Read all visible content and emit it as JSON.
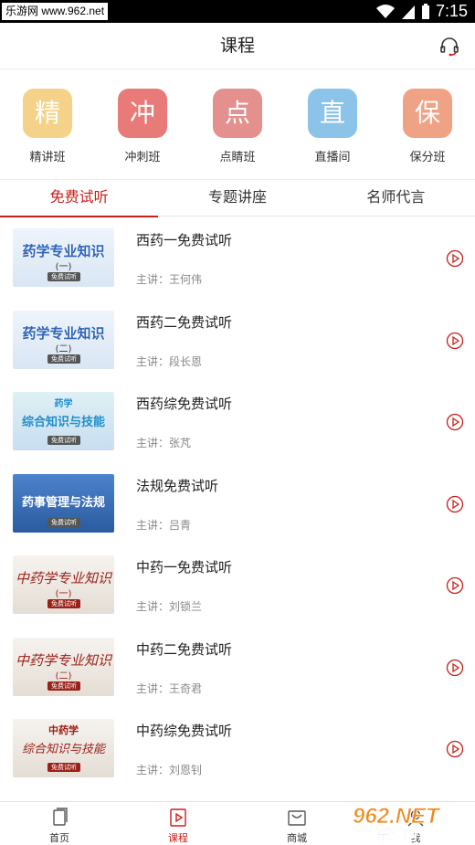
{
  "status_bar": {
    "watermark": "乐游网 www.962.net",
    "time": "7:15"
  },
  "header": {
    "title": "课程",
    "support_icon": "headset-icon"
  },
  "categories": [
    {
      "glyph": "精",
      "label": "精讲班",
      "color": "#f4d28a"
    },
    {
      "glyph": "冲",
      "label": "冲刺班",
      "color": "#e87a78"
    },
    {
      "glyph": "点",
      "label": "点睛班",
      "color": "#e3908f"
    },
    {
      "glyph": "直",
      "label": "直播间",
      "color": "#8cc3e9"
    },
    {
      "glyph": "保",
      "label": "保分班",
      "color": "#f0a285"
    }
  ],
  "tabs": [
    {
      "label": "免费试听",
      "active": true
    },
    {
      "label": "专题讲座",
      "active": false
    },
    {
      "label": "名师代言",
      "active": false
    }
  ],
  "courses": [
    {
      "title": "西药一免费试听",
      "teacher": "主讲：王何伟",
      "thumb_title": "药学专业知识",
      "thumb_sub": "(一)",
      "thumb_badge": "免费试听",
      "style": "blue"
    },
    {
      "title": "西药二免费试听",
      "teacher": "主讲：段长恩",
      "thumb_title": "药学专业知识",
      "thumb_sub": "(二)",
      "thumb_badge": "免费试听",
      "style": "blue"
    },
    {
      "title": "西药综免费试听",
      "teacher": "主讲：张芃",
      "thumb_title": "综合知识与技能",
      "thumb_sub": "药学",
      "thumb_badge": "免费试听",
      "style": "blue2"
    },
    {
      "title": "法规免费试听",
      "teacher": "主讲：吕青",
      "thumb_title": "药事管理与法规",
      "thumb_sub": "",
      "thumb_badge": "免费试听",
      "style": "dark"
    },
    {
      "title": "中药一免费试听",
      "teacher": "主讲：刘锁兰",
      "thumb_title": "中药学专业知识",
      "thumb_sub": "(一)",
      "thumb_badge": "免费试听",
      "style": "paper"
    },
    {
      "title": "中药二免费试听",
      "teacher": "主讲：王奇君",
      "thumb_title": "中药学专业知识",
      "thumb_sub": "(二)",
      "thumb_badge": "免费试听",
      "style": "paper"
    },
    {
      "title": "中药综免费试听",
      "teacher": "主讲：刘恩钊",
      "thumb_title": "综合知识与技能",
      "thumb_sub": "中药学",
      "thumb_badge": "免费试听",
      "style": "paper"
    }
  ],
  "bottom_nav": [
    {
      "label": "首页",
      "icon": "home-icon",
      "active": false
    },
    {
      "label": "课程",
      "icon": "play-square-icon",
      "active": true
    },
    {
      "label": "商城",
      "icon": "mall-icon",
      "active": false
    },
    {
      "label": "我",
      "icon": "profile-icon",
      "active": false
    }
  ],
  "watermark_br": "962.NET 乐游网",
  "colors": {
    "accent": "#c8201a"
  }
}
